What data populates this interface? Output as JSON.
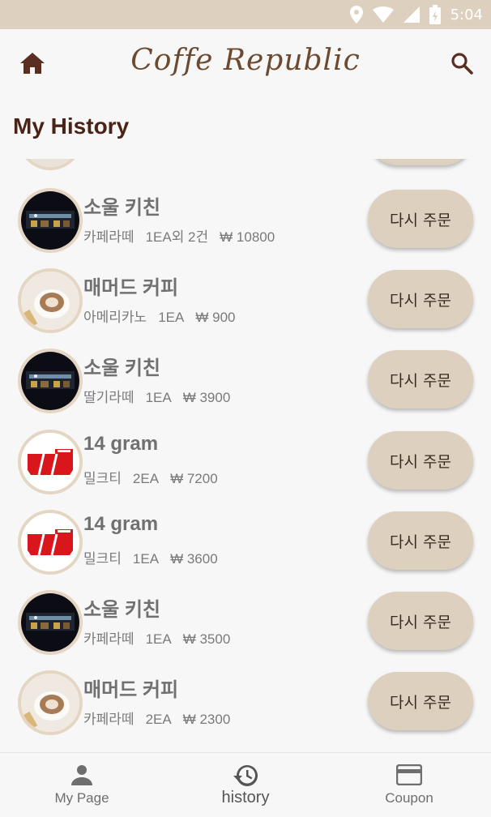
{
  "status_bar": {
    "time": "5:04",
    "icons": [
      "location-icon",
      "wifi-icon",
      "signal-icon",
      "battery-charging-icon"
    ]
  },
  "app_bar": {
    "title": "Coffe Republic",
    "left_icon": "home-icon",
    "right_icon": "search-icon"
  },
  "page": {
    "title": "My History"
  },
  "history": [
    {
      "store": "소울 키친",
      "item": "카페라떼",
      "qty": "1EA외 2건",
      "price": "₩ 10800",
      "thumb": "soul-kitchen",
      "button": "다시 주문"
    },
    {
      "store": "매머드 커피",
      "item": "아메리카노",
      "qty": "1EA",
      "price": "₩ 900",
      "thumb": "mammoth-coffee",
      "button": "다시 주문"
    },
    {
      "store": "소울 키친",
      "item": "딸기라떼",
      "qty": "1EA",
      "price": "₩ 3900",
      "thumb": "soul-kitchen",
      "button": "다시 주문"
    },
    {
      "store": "14 gram",
      "item": "밀크티",
      "qty": "2EA",
      "price": "₩ 7200",
      "thumb": "14-gram",
      "button": "다시 주문"
    },
    {
      "store": "14 gram",
      "item": "밀크티",
      "qty": "1EA",
      "price": "₩ 3600",
      "thumb": "14-gram",
      "button": "다시 주문"
    },
    {
      "store": "소울 키친",
      "item": "카페라떼",
      "qty": "1EA",
      "price": "₩ 3500",
      "thumb": "soul-kitchen",
      "button": "다시 주문"
    },
    {
      "store": "매머드 커피",
      "item": "카페라떼",
      "qty": "2EA",
      "price": "₩ 2300",
      "thumb": "mammoth-coffee",
      "button": "다시 주문"
    }
  ],
  "bottom_nav": [
    {
      "label": "My Page",
      "icon": "person-icon",
      "active": false
    },
    {
      "label": "history",
      "icon": "history-icon",
      "active": true
    },
    {
      "label": "Coupon",
      "icon": "credit-card-icon",
      "active": false
    }
  ],
  "colors": {
    "accent": "#ddd0be",
    "title": "#4a2318",
    "brand": "#6b4a31"
  }
}
